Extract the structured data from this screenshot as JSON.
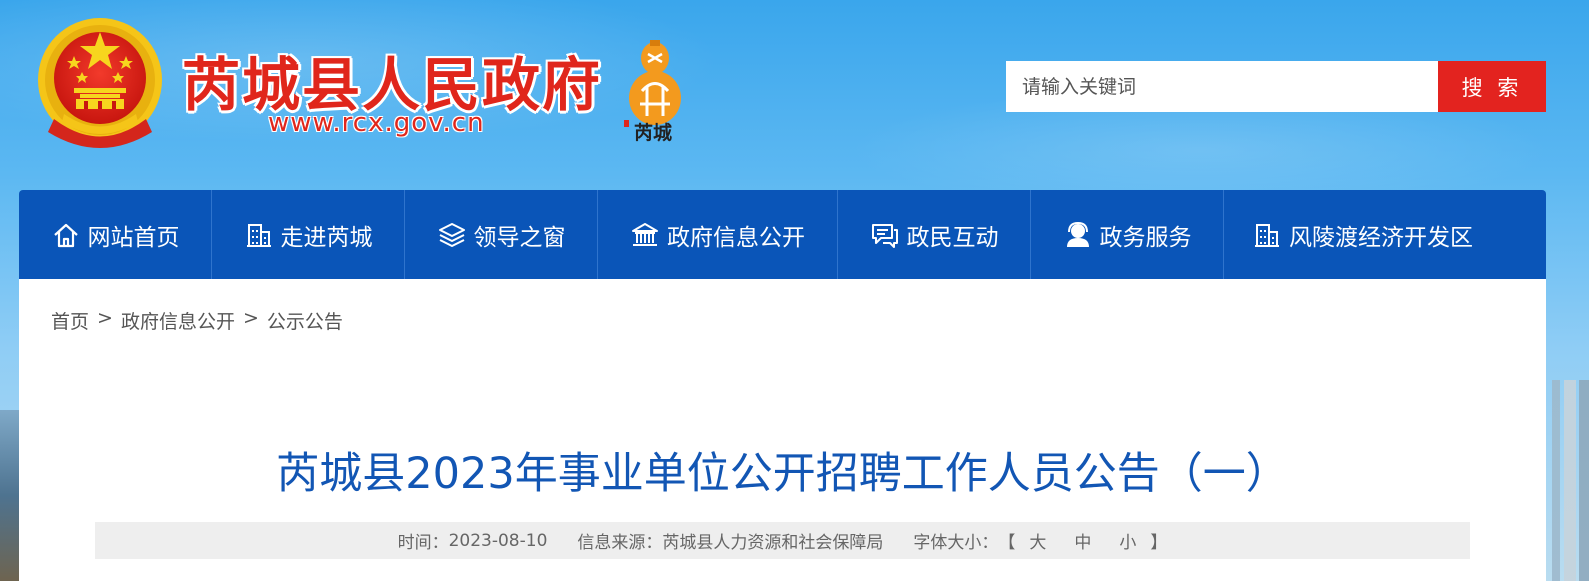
{
  "header": {
    "site_title": "芮城县人民政府",
    "site_url": "www.rcx.gov.cn",
    "city_logo_text": "芮城"
  },
  "search": {
    "placeholder": "请输入关键词",
    "button_label": "搜 索"
  },
  "nav": {
    "items": [
      {
        "label": "网站首页",
        "icon": "home-icon"
      },
      {
        "label": "走进芮城",
        "icon": "building-icon"
      },
      {
        "label": "领导之窗",
        "icon": "layers-icon"
      },
      {
        "label": "政府信息公开",
        "icon": "institution-icon"
      },
      {
        "label": "政民互动",
        "icon": "chat-icon"
      },
      {
        "label": "政务服务",
        "icon": "service-user-icon"
      },
      {
        "label": "风陵渡经济开发区",
        "icon": "building-icon"
      }
    ]
  },
  "breadcrumb": {
    "home": "首页",
    "sep": ">",
    "level1": "政府信息公开",
    "level2": "公示公告"
  },
  "article": {
    "title": "芮城县2023年事业单位公开招聘工作人员公告（一）",
    "time_label": "时间：",
    "time_value": "2023-08-10",
    "source_label": "信息来源：",
    "source_value": "芮城县人力资源和社会保障局",
    "font_size_label": "字体大小：",
    "bracket_open": "【",
    "size_large": "大",
    "size_medium": "中",
    "size_small": "小",
    "bracket_close": "】"
  },
  "colors": {
    "nav_bg": "#0a55b8",
    "title_blue": "#1256b4",
    "brand_red": "#e0261b",
    "search_btn": "#e3231f"
  }
}
